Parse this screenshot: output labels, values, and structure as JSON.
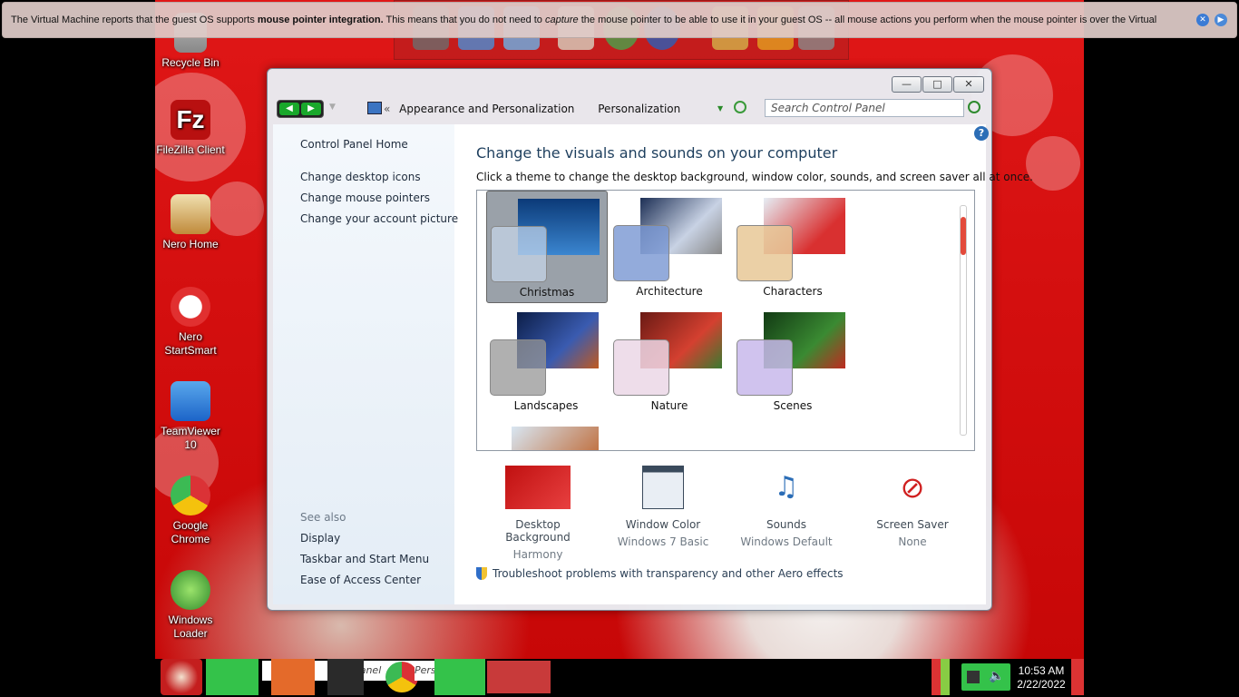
{
  "vm_notice": {
    "text_before": "The Virtual Machine reports that the guest OS supports ",
    "bold": "mouse pointer integration.",
    "text_mid": " This means that you do not need to ",
    "italic": "capture",
    "text_after": " the mouse pointer to be able to use it in your guest OS -- all mouse actions you perform when the mouse pointer is over the Virtual"
  },
  "desktop_icons": [
    {
      "label": "Recycle Bin",
      "icon": "recycle-bin-icon"
    },
    {
      "label": "FileZilla Client",
      "icon": "filezilla-icon"
    },
    {
      "label": "Nero Home",
      "icon": "nero-home-icon"
    },
    {
      "label": "Nero StartSmart",
      "icon": "nero-startsmart-icon"
    },
    {
      "label": "TeamViewer 10",
      "icon": "teamviewer-icon"
    },
    {
      "label": "Google Chrome",
      "icon": "chrome-icon"
    },
    {
      "label": "Windows Loader",
      "icon": "windows-loader-icon"
    }
  ],
  "window": {
    "breadcrumb": [
      "Appearance and Personalization",
      "Personalization"
    ],
    "search_placeholder": "Search Control Panel",
    "left_links": [
      "Control Panel Home",
      "Change desktop icons",
      "Change mouse pointers",
      "Change your account picture"
    ],
    "see_also_title": "See also",
    "see_also_links": [
      "Display",
      "Taskbar and Start Menu",
      "Ease of Access Center"
    ],
    "heading": "Change the visuals and sounds on your computer",
    "subheading": "Click a theme to change the desktop background, window color, sounds, and screen saver all at once.",
    "themes": [
      {
        "name": "Christmas",
        "selected": true,
        "color": "#1f5fa8"
      },
      {
        "name": "Architecture",
        "selected": false,
        "color": "#7d93b8"
      },
      {
        "name": "Characters",
        "selected": false,
        "color": "#d98a2e"
      },
      {
        "name": "Landscapes",
        "selected": false,
        "color": "#2b3566"
      },
      {
        "name": "Nature",
        "selected": false,
        "color": "#b03828"
      },
      {
        "name": "Scenes",
        "selected": false,
        "color": "#2f6b2a"
      }
    ],
    "settings": [
      {
        "title": "Desktop Background",
        "value": "Harmony",
        "icon": "desktop-background-icon"
      },
      {
        "title": "Window Color",
        "value": "Windows 7 Basic",
        "icon": "window-color-icon"
      },
      {
        "title": "Sounds",
        "value": "Windows Default",
        "icon": "sounds-icon"
      },
      {
        "title": "Screen Saver",
        "value": "None",
        "icon": "screen-saver-icon"
      }
    ],
    "troubleshoot": "Troubleshoot problems with transparency and other Aero effects"
  },
  "taskbar": {
    "time": "10:53 AM",
    "date": "2/22/2022",
    "task_text_1": "ntrol Panel",
    "task_text_2": "Pers"
  }
}
